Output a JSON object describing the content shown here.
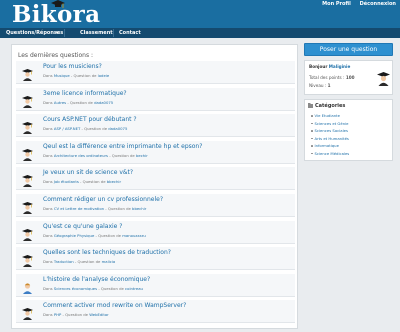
{
  "header": {
    "logo": "Bikora",
    "links": [
      "Mon Profil",
      "Déconnexion"
    ]
  },
  "nav": {
    "items": [
      "Questions/Réponses",
      "Classement",
      "Contact"
    ]
  },
  "main": {
    "title": "Les dernières questions :",
    "questions": [
      {
        "title": "Pour les musiciens?",
        "prefix": "Dans ",
        "category": "Musique",
        "middle": " - Question de ",
        "author": "lodeie",
        "icon": "graduate-icon"
      },
      {
        "title": "3eme licence informatique?",
        "prefix": "Dans ",
        "category": "Autres",
        "middle": " - Question de ",
        "author": "dada0075",
        "icon": "graduate-icon"
      },
      {
        "title": "Cours ASP.NET pour débutant ?",
        "prefix": "Dans ",
        "category": "ASP / ASP.NET",
        "middle": " - Question de ",
        "author": "dada0075",
        "icon": "graduate-icon"
      },
      {
        "title": "Qeul est la différence entre imprimante hp et epson?",
        "prefix": "Dans ",
        "category": "Architecture des ordinateurs",
        "middle": " - Question de ",
        "author": "bechir",
        "icon": "graduate-icon"
      },
      {
        "title": "Je veux un sit de science v&t?",
        "prefix": "Dans ",
        "category": "Job étudiants",
        "middle": " - Question de ",
        "author": "bbechir",
        "icon": "graduate-icon"
      },
      {
        "title": "Comment rédiger un cv professionnele?",
        "prefix": "Dans ",
        "category": "CV et Lettre de motivation",
        "middle": " - Question de ",
        "author": "bbechir",
        "icon": "graduate-icon"
      },
      {
        "title": "Qu'est ce qu'une galaxie ?",
        "prefix": "Dans ",
        "category": "Géographie Physique",
        "middle": " - Question de ",
        "author": "manouzzzzu",
        "icon": "graduate-icon"
      },
      {
        "title": "Quelles sont les techniques de traduction?",
        "prefix": "Dans ",
        "category": "Traduction",
        "middle": " - Question de ",
        "author": "malicia",
        "icon": "graduate-icon"
      },
      {
        "title": "L'histoire de l'analyse économique?",
        "prefix": "Dans ",
        "category": "Sciences économiques",
        "middle": " - Question de ",
        "author": "cointreau",
        "icon": "student-icon"
      },
      {
        "title": "Comment activer mod rewrite on WampServer?",
        "prefix": "Dans ",
        "category": "PHP",
        "middle": " - Question de ",
        "author": "WebEditor",
        "icon": "graduate-icon"
      }
    ]
  },
  "sidebar": {
    "ask_button": "Poser une question",
    "user": {
      "hello": "Bonjour",
      "name": "Maliginie",
      "points_label": "Total des points :",
      "points": "100",
      "level_label": "Niveau :",
      "level": "1"
    },
    "categories": {
      "title": "Catégories",
      "items": [
        "Vie Etudiante",
        "Sciences et Génie",
        "Sciences Sociales",
        "Arts et Humanités",
        "Informatique",
        "Science Médicales"
      ]
    }
  },
  "colors": {
    "header": "#1a6ea1",
    "nav": "#144a6f",
    "link": "#1d6fa8",
    "button": "#2e90d0"
  }
}
